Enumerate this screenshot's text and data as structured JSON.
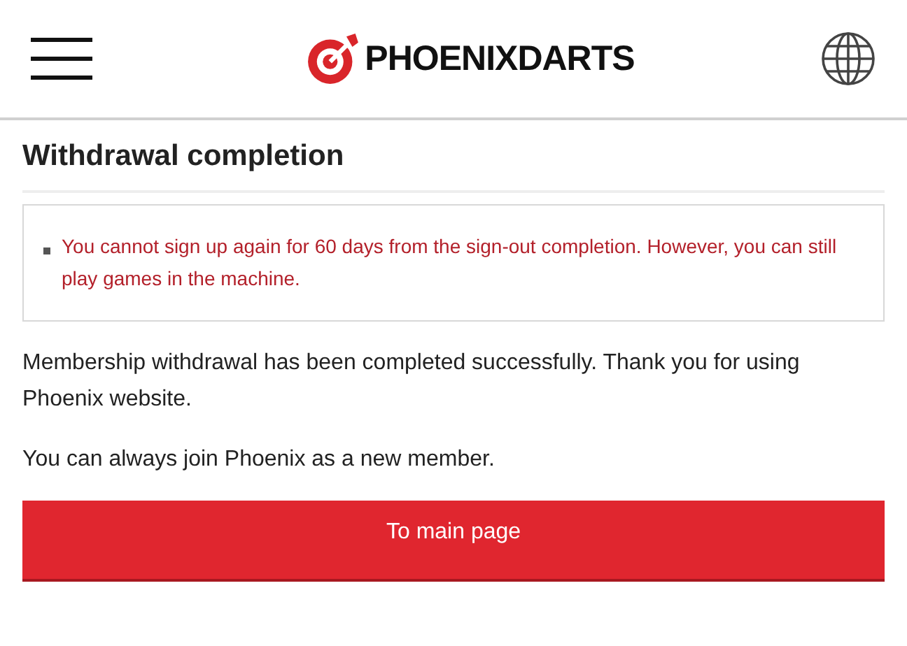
{
  "header": {
    "brand": "PHOENIXDARTS"
  },
  "title": "Withdrawal completion",
  "notices": [
    "You cannot sign up again for 60 days from the sign-out completion. However, you can still play games in the machine."
  ],
  "paragraphs": [
    "Membership withdrawal has been completed successfully. Thank you for using Phoenix website.",
    "You can always join Phoenix as a new member."
  ],
  "button": "To main page"
}
